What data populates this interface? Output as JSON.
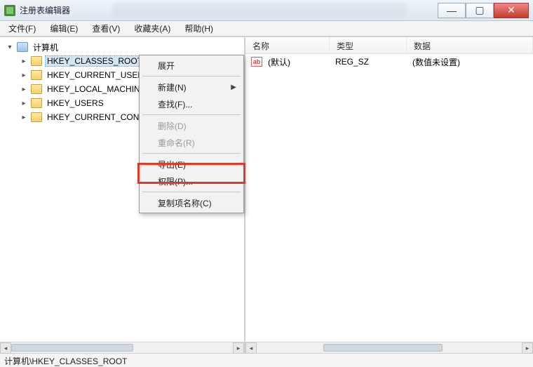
{
  "window": {
    "title": "注册表编辑器"
  },
  "menu": {
    "file": "文件(F)",
    "edit": "编辑(E)",
    "view": "查看(V)",
    "favorites": "收藏夹(A)",
    "help": "帮助(H)"
  },
  "tree": {
    "root": "计算机",
    "items": [
      "HKEY_CLASSES_ROOT",
      "HKEY_CURRENT_USER",
      "HKEY_LOCAL_MACHINE",
      "HKEY_USERS",
      "HKEY_CURRENT_CONFIG"
    ],
    "selected_index": 0
  },
  "columns": {
    "name": "名称",
    "type": "类型",
    "data": "数据"
  },
  "values": [
    {
      "icon": "ab",
      "name": "(默认)",
      "type": "REG_SZ",
      "data": "(数值未设置)"
    }
  ],
  "context_menu": {
    "expand": "展开",
    "new": "新建(N)",
    "find": "查找(F)...",
    "delete": "删除(D)",
    "rename": "重命名(R)",
    "export": "导出(E)",
    "permissions": "权限(P)...",
    "copy_key_name": "复制项名称(C)"
  },
  "statusbar": {
    "path": "计算机\\HKEY_CLASSES_ROOT"
  }
}
